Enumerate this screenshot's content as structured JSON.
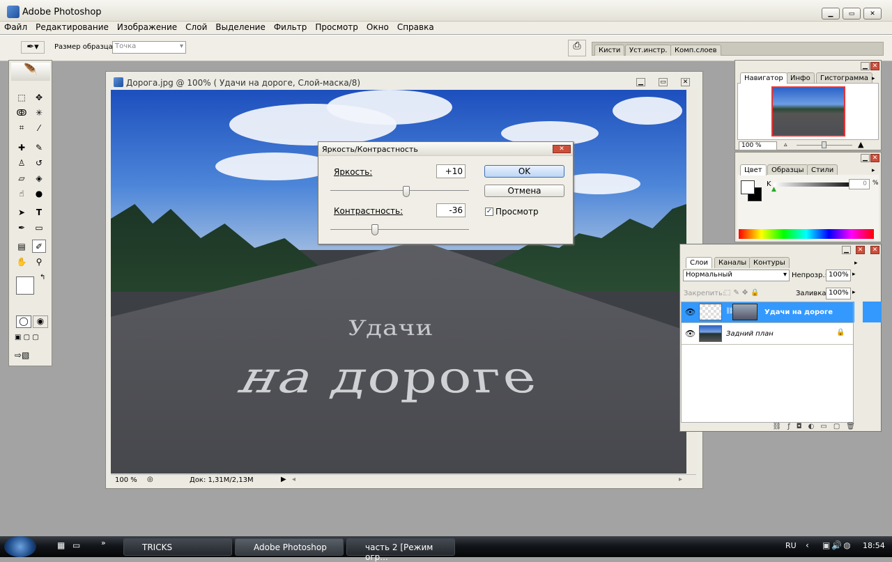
{
  "window": {
    "title": "Adobe Photoshop"
  },
  "menu": [
    "Файл",
    "Редактирование",
    "Изображение",
    "Слой",
    "Выделение",
    "Фильтр",
    "Просмотр",
    "Окно",
    "Справка"
  ],
  "options": {
    "sample_label": "Размер образца:",
    "sample_value": "Точка",
    "well_tabs": [
      "Кисти",
      "Уст.инстр.",
      "Комп.слоев"
    ]
  },
  "document": {
    "title": "Дорога.jpg @ 100% (  Удачи  на дороге, Слой-маска/8)",
    "image_text_line1": "Удачи",
    "image_text_line2": "на дороге",
    "zoom": "100 %",
    "doc_size": "Док: 1,31M/2,13M"
  },
  "dialog": {
    "title": "Яркость/Контрастность",
    "brightness_label": "Яркость:",
    "brightness_value": "+10",
    "contrast_label": "Контрастность:",
    "contrast_value": "-36",
    "ok": "OK",
    "cancel": "Отмена",
    "preview_label": "Просмотр",
    "preview_checked": true,
    "brightness_pct": 0.55,
    "contrast_pct": 0.32
  },
  "navigator": {
    "tabs": [
      "Навигатор",
      "Инфо",
      "Гистограмма"
    ],
    "zoom": "100 %"
  },
  "color": {
    "tabs": [
      "Цвет",
      "Образцы",
      "Стили"
    ],
    "channel": "K",
    "value": "0",
    "unit": "%"
  },
  "layers": {
    "tabs": [
      "Слои",
      "Каналы",
      "Контуры"
    ],
    "blend_mode": "Нормальный",
    "opacity_label": "Непрозр.:",
    "opacity": "100%",
    "lock_label": "Закрепить:",
    "fill_label": "Заливка:",
    "fill": "100%",
    "items": [
      {
        "name": "Удачи  на дороге",
        "selected": true
      },
      {
        "name": "Задний план",
        "selected": false
      }
    ]
  },
  "taskbar": {
    "tasks": [
      "TRICKS",
      "Adobe Photoshop",
      "часть 2 [Режим огр..."
    ],
    "lang": "RU",
    "time": "18:54",
    "chevron": "»"
  },
  "colors": {
    "selection": "#3399ff",
    "close": "#cc4f3a",
    "accent": "#1f4f9c"
  }
}
